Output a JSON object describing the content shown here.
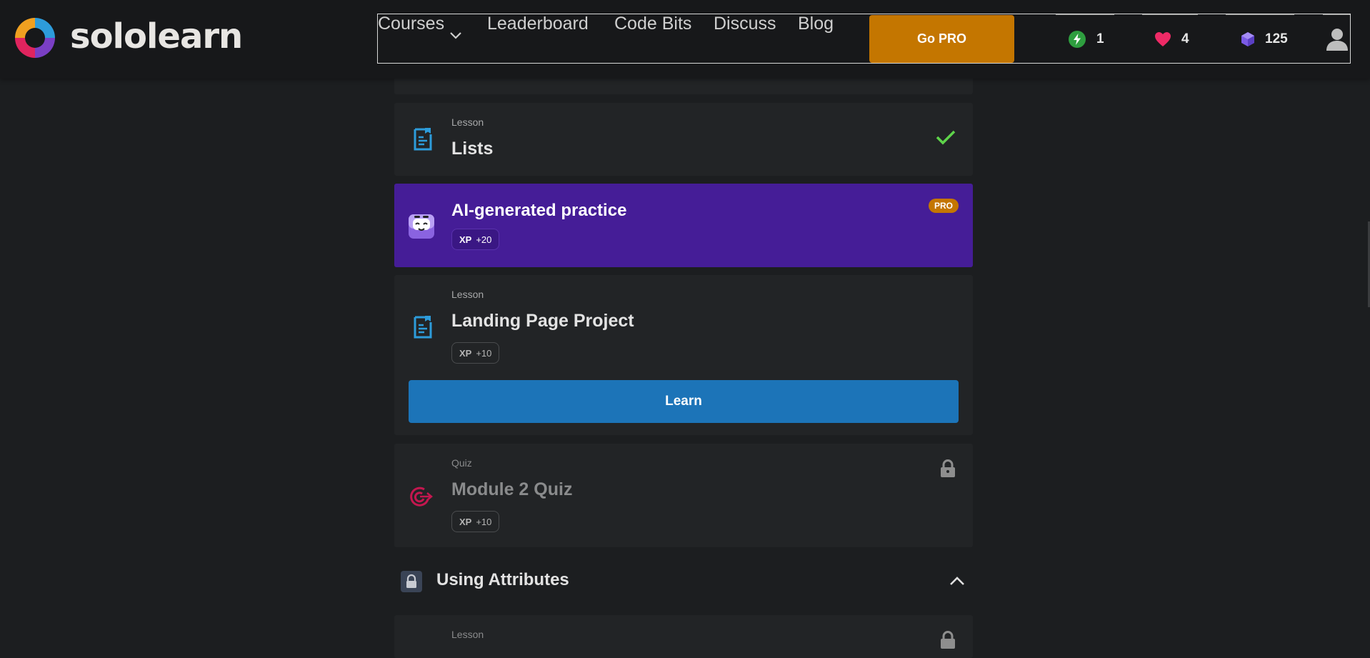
{
  "brand": {
    "name": "sololearn"
  },
  "nav": {
    "courses": "Courses",
    "leaderboard": "Leaderboard",
    "code_bits": "Code Bits",
    "discuss": "Discuss",
    "blog": "Blog",
    "go_pro": "Go PRO"
  },
  "stats": {
    "streak": "1",
    "hearts": "4",
    "gems": "125"
  },
  "items": [
    {
      "kind": "Lesson",
      "title": "Lists",
      "status": "completed"
    },
    {
      "title": "AI-generated practice",
      "badge": "PRO",
      "xp_label": "XP",
      "xp_value": "+20"
    },
    {
      "kind": "Lesson",
      "title": "Landing Page Project",
      "xp_label": "XP",
      "xp_value": "+10",
      "action": "Learn"
    },
    {
      "kind": "Quiz",
      "title": "Module 2 Quiz",
      "xp_label": "XP",
      "xp_value": "+10",
      "status": "locked"
    }
  ],
  "section": {
    "title": "Using Attributes",
    "status": "locked",
    "expanded": true
  },
  "next_item": {
    "kind": "Lesson",
    "status": "locked"
  },
  "colors": {
    "background": "#1c1e20",
    "card": "#222426",
    "pro": "#c47600",
    "ai_card": "#451d97",
    "learn_button": "#1c74b8",
    "check": "#5ed44a",
    "lesson_icon": "#2d9cdb",
    "quiz_icon": "#c4174f"
  },
  "icons": {
    "logo": "sololearn-logo",
    "streak": "bolt-icon",
    "hearts": "heart-icon",
    "gems": "gem-icon",
    "profile": "user-icon",
    "lesson": "lesson-doc-icon",
    "quiz": "target-icon",
    "completed": "check-icon",
    "locked": "lock-icon",
    "collapse": "chevron-up-icon",
    "ai": "ai-bot-icon"
  }
}
